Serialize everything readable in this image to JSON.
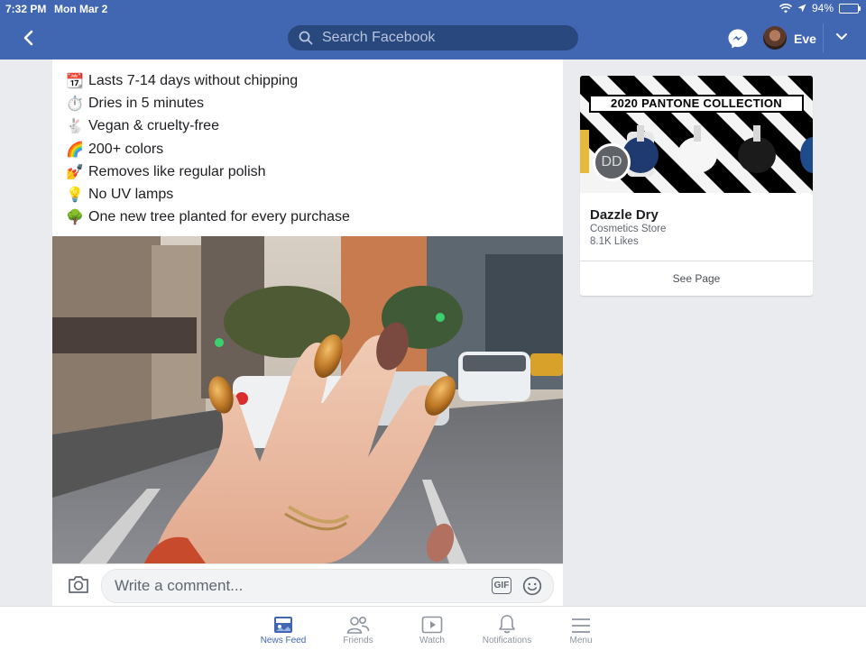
{
  "status_bar": {
    "time": "7:32 PM",
    "date": "Mon Mar 2",
    "battery": "94%",
    "battery_level": 0.94
  },
  "header": {
    "search_placeholder": "Search Facebook",
    "user_name": "Eve",
    "icons": [
      "back-chevron-icon",
      "search-icon",
      "messenger-icon",
      "chevron-down-icon"
    ],
    "accent": "#4267b2"
  },
  "post": {
    "features": [
      {
        "emoji": "📆",
        "text": "Lasts 7-14 days without chipping"
      },
      {
        "emoji": "⏱️",
        "text": "Dries in 5 minutes"
      },
      {
        "emoji": "🐇",
        "text": "Vegan & cruelty-free"
      },
      {
        "emoji": "🌈",
        "text": "200+ colors"
      },
      {
        "emoji": "💅",
        "text": "Removes like regular polish"
      },
      {
        "emoji": "💡",
        "text": "No UV lamps"
      },
      {
        "emoji": "🌳",
        "text": "One new tree planted for every purchase"
      }
    ],
    "comment_placeholder": "Write a comment...",
    "gif_label": "GIF"
  },
  "page_card": {
    "cover_title": "2020 PANTONE COLLECTION",
    "avatar_initials": "DD",
    "name": "Dazzle Dry",
    "category": "Cosmetics Store",
    "likes": "8.1K Likes",
    "button": "See Page"
  },
  "tabs": [
    {
      "label": "News Feed",
      "icon": "news-feed-icon",
      "active": true
    },
    {
      "label": "Friends",
      "icon": "friends-icon",
      "active": false
    },
    {
      "label": "Watch",
      "icon": "watch-icon",
      "active": false
    },
    {
      "label": "Notifications",
      "icon": "bell-icon",
      "active": false
    },
    {
      "label": "Menu",
      "icon": "menu-icon",
      "active": false
    }
  ]
}
